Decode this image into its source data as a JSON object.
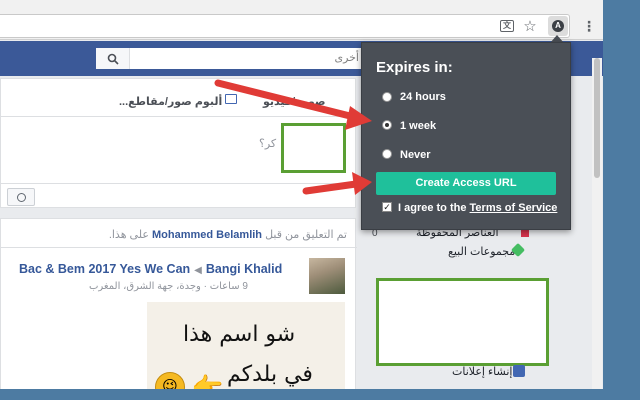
{
  "browser": {
    "translate_glyph": "文",
    "star_glyph": "☆",
    "extension_glyph": "A",
    "menu_glyph": "⋮"
  },
  "facebook": {
    "search_placeholder": "أخرى",
    "composer": {
      "tab_photo": "صورة/فيديو",
      "tab_album": "ألبوم صور/مقاطع...",
      "prompt": "كر؟"
    },
    "post": {
      "notice_pre": "تم التعليق من قبل",
      "notice_name": "Mohammed Belamlih",
      "notice_post": "على هذا.",
      "author": "Bangi Khalid",
      "target": "Bac & Bem 2017 Yes We Can",
      "meta": "9 ساعات · وجدة، جهة الشرق، المغرب",
      "image_line1": "شو اسم هذا",
      "image_line2": "في بلدكم"
    },
    "sidebar": {
      "item1": "العناصر المحفوظة",
      "item1_count": "0",
      "item2": "مجموعات البيع",
      "item3": "إنشاء إعلانات"
    }
  },
  "popup": {
    "title": "Expires in:",
    "options": [
      {
        "label": "24 hours",
        "selected": false
      },
      {
        "label": "1 week",
        "selected": true
      },
      {
        "label": "Never",
        "selected": false
      }
    ],
    "create_button": "Create Access URL",
    "agree_prefix": "I agree to the",
    "terms_link": "Terms of Service",
    "agree_checked": true
  },
  "colors": {
    "background": "#4d7ba2",
    "facebook_blue": "#3b5998",
    "popup_bg": "#4a4f56",
    "create_button": "#1fc09b",
    "highlight_box": "#5a9f33",
    "arrow": "#e03b36"
  }
}
